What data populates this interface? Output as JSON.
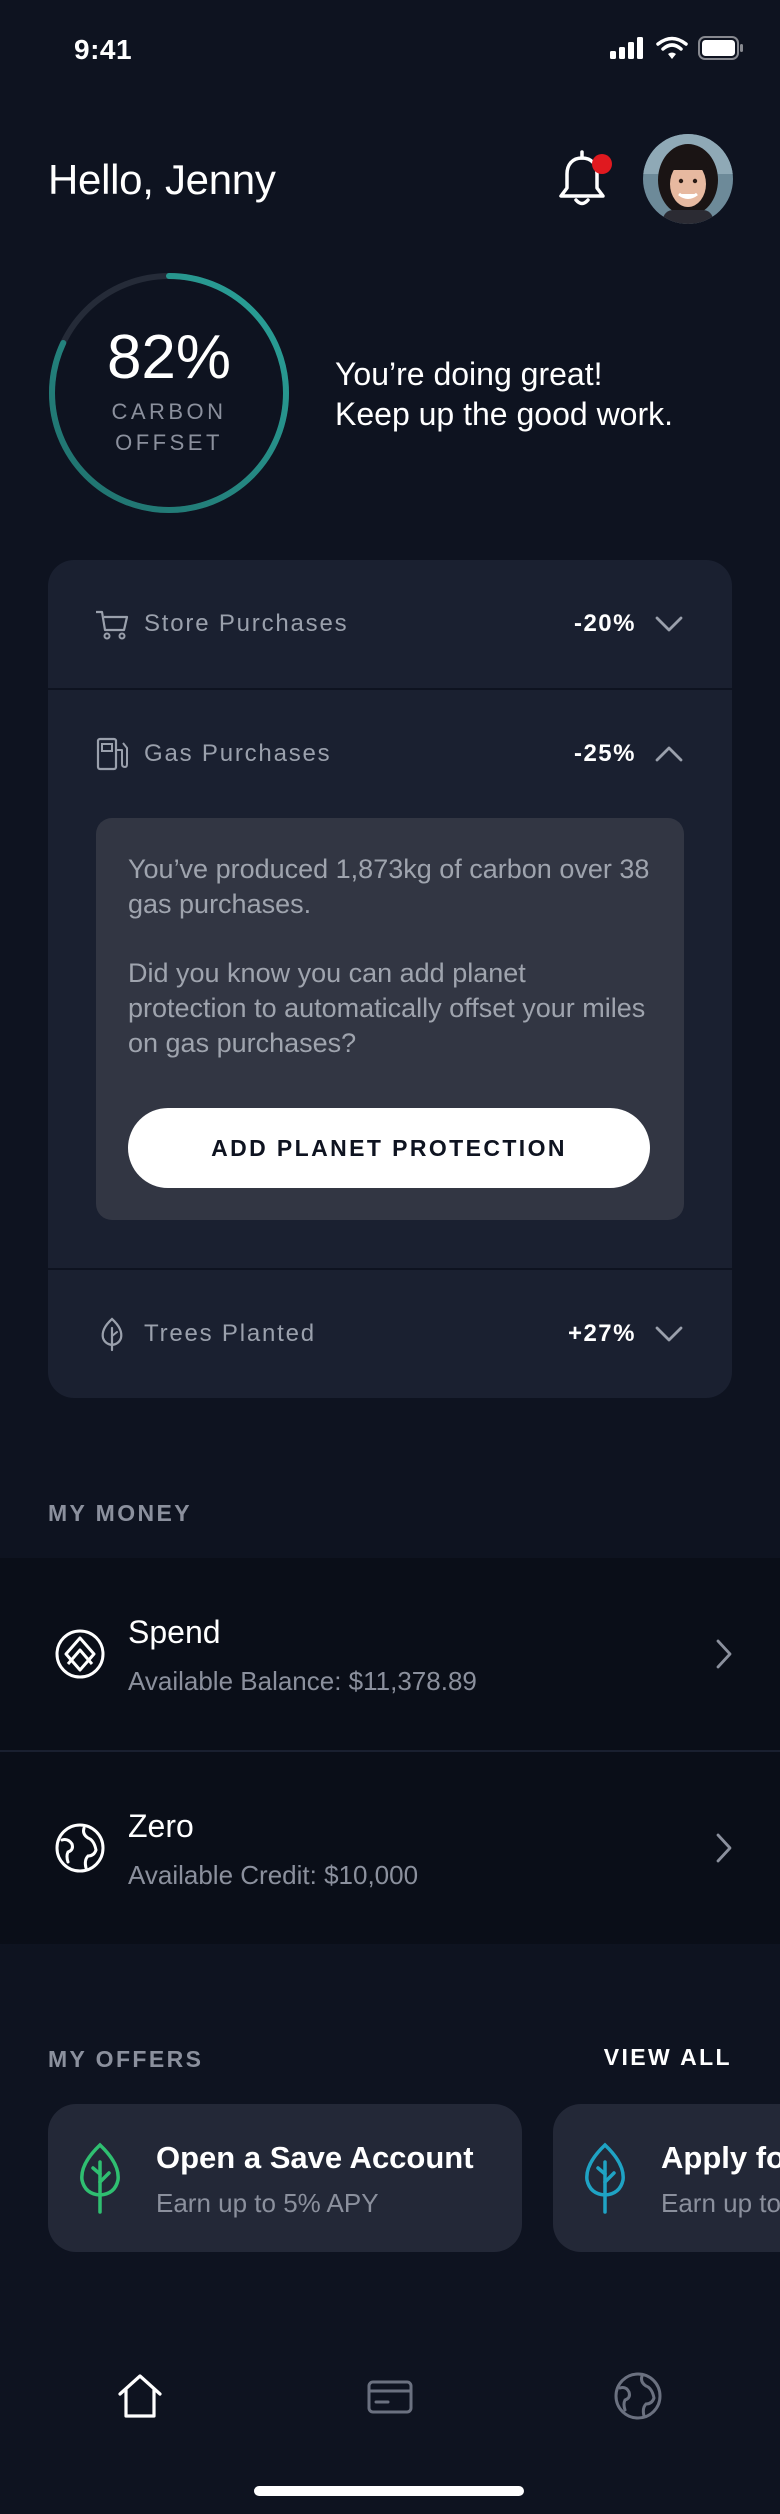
{
  "status_bar": {
    "time": "9:41"
  },
  "header": {
    "greeting": "Hello, Jenny"
  },
  "carbon": {
    "percent_text": "82%",
    "percent_value": 0.82,
    "label": "CARBON\nOFFSET",
    "message": "You’re doing great!\nKeep up the good work."
  },
  "purchases": {
    "rows": [
      {
        "label": "Store Purchases",
        "value": "-20%",
        "icon": "shopping-cart-icon",
        "expanded": false
      },
      {
        "label": "Gas Purchases",
        "value": "-25%",
        "icon": "gas-pump-icon",
        "expanded": true
      },
      {
        "label": "Trees Planted",
        "value": "+27%",
        "icon": "leaf-icon",
        "expanded": false
      }
    ],
    "info": {
      "paragraph1": "You’ve produced 1,873kg of carbon over 38 gas purchases.",
      "paragraph2": "Did you know you can add planet protection to automatically offset your miles on gas purchases?",
      "button": "ADD PLANET PROTECTION"
    }
  },
  "my_money": {
    "title": "MY MONEY",
    "accounts": [
      {
        "name": "Spend",
        "detail": "Available Balance: $11,378.89",
        "icon": "spend-logo-icon"
      },
      {
        "name": "Zero",
        "detail": "Available Credit: $10,000",
        "icon": "globe-icon"
      }
    ]
  },
  "offers": {
    "title": "MY OFFERS",
    "view_all": "VIEW ALL",
    "items": [
      {
        "title": "Open a Save Account",
        "subtitle": "Earn up to 5% APY",
        "icon": "tree-icon",
        "icon_color": "#2fbf71"
      },
      {
        "title": "Apply fo",
        "subtitle": "Earn up to",
        "icon": "tree-icon",
        "icon_color": "#1fa3c4"
      }
    ]
  },
  "tab_bar": {
    "tabs": [
      {
        "name": "home",
        "icon": "home-icon",
        "active": true
      },
      {
        "name": "card",
        "icon": "card-icon",
        "active": false
      },
      {
        "name": "globe",
        "icon": "globe-icon",
        "active": false
      }
    ]
  },
  "colors": {
    "background": "#0e1320",
    "card": "#1a2030",
    "ring_accent": "#2a9d94",
    "notification": "#e0191f"
  }
}
